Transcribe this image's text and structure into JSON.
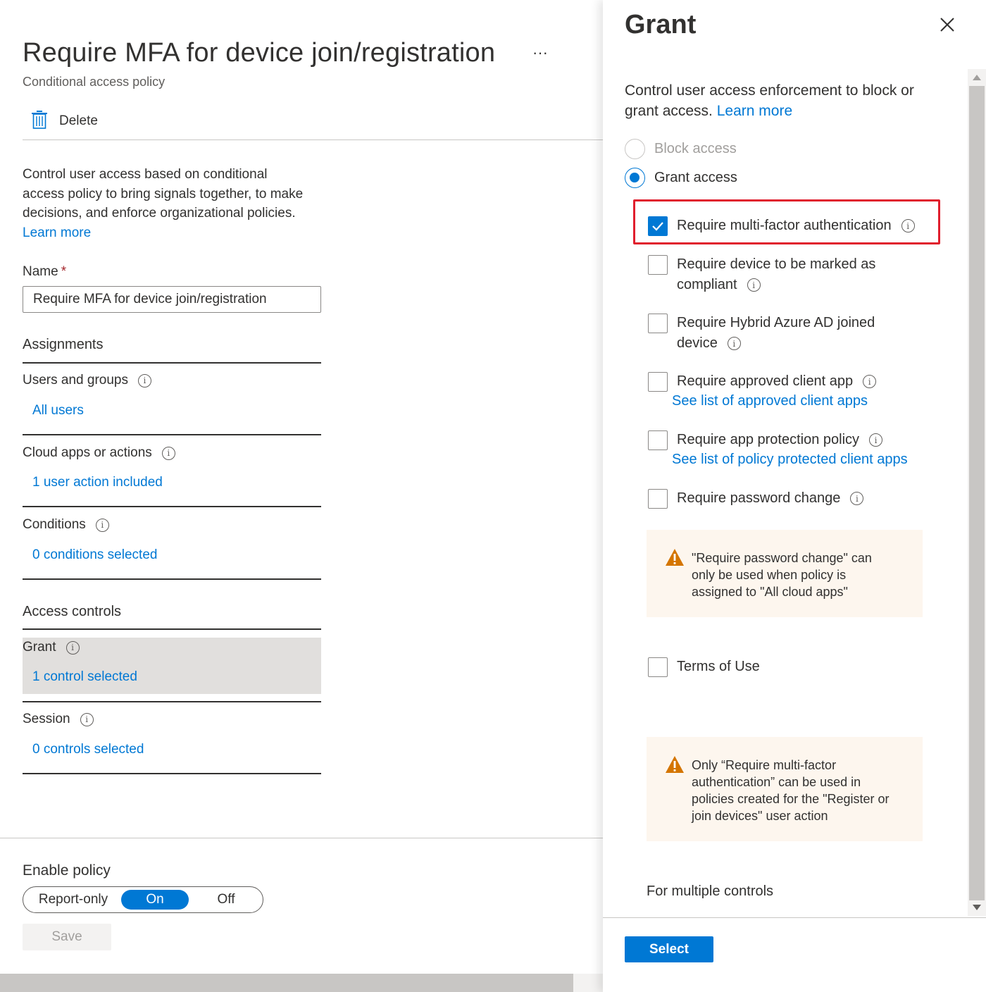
{
  "policy": {
    "title": "Require MFA for device join/registration",
    "subtitle": "Conditional access policy",
    "more_label": "···",
    "toolbar": {
      "delete_label": "Delete"
    },
    "description": "Control user access based on conditional access policy to bring signals together, to make decisions, and enforce organizational policies.",
    "learn_more": "Learn more",
    "name_label": "Name",
    "name_required": "*",
    "name_value": "Require MFA for device join/registration",
    "assignments_title": "Assignments",
    "users_label": "Users and groups",
    "users_value": "All users",
    "cloud_label": "Cloud apps or actions",
    "cloud_value": "1 user action included",
    "conditions_label": "Conditions",
    "conditions_value": "0 conditions selected",
    "access_controls_title": "Access controls",
    "grant_label": "Grant",
    "grant_value": "1 control selected",
    "session_label": "Session",
    "session_value": "0 controls selected",
    "enable_policy_label": "Enable policy",
    "enable_options": [
      "Report-only",
      "On",
      "Off"
    ],
    "enable_selected": "On",
    "save_label": "Save"
  },
  "grant_panel": {
    "title": "Grant",
    "description": "Control user access enforcement to block or grant access.",
    "learn_more": "Learn more",
    "block_access_label": "Block access",
    "grant_access_label": "Grant access",
    "selected_mode": "Grant access",
    "controls": [
      {
        "label": "Require multi-factor authentication",
        "checked": true
      },
      {
        "label": "Require device to be marked as compliant",
        "checked": false
      },
      {
        "label": "Require Hybrid Azure AD joined device",
        "checked": false
      },
      {
        "label": "Require approved client app",
        "checked": false,
        "link": "See list of approved client apps"
      },
      {
        "label": "Require app protection policy",
        "checked": false,
        "link": "See list of policy protected client apps"
      },
      {
        "label": "Require password change",
        "checked": false
      },
      {
        "label": "Terms of Use",
        "checked": false
      }
    ],
    "control_lines": {
      "compliant_line1": "Require device to be marked as",
      "compliant_line2": "compliant",
      "hybrid_line1": "Require Hybrid Azure AD joined",
      "hybrid_line2": "device"
    },
    "warning_password": "\"Require password change\" can only be used when policy is assigned to \"All cloud apps\"",
    "warning_mfa": "Only “Require multi-factor authentication” can be used in policies created for the \"Register or join devices\" user action",
    "multiple_controls_label": "For multiple controls",
    "select_label": "Select",
    "colors": {
      "accent": "#0078d4",
      "highlight_border": "#e01e2d",
      "warning": "#d47500"
    }
  }
}
